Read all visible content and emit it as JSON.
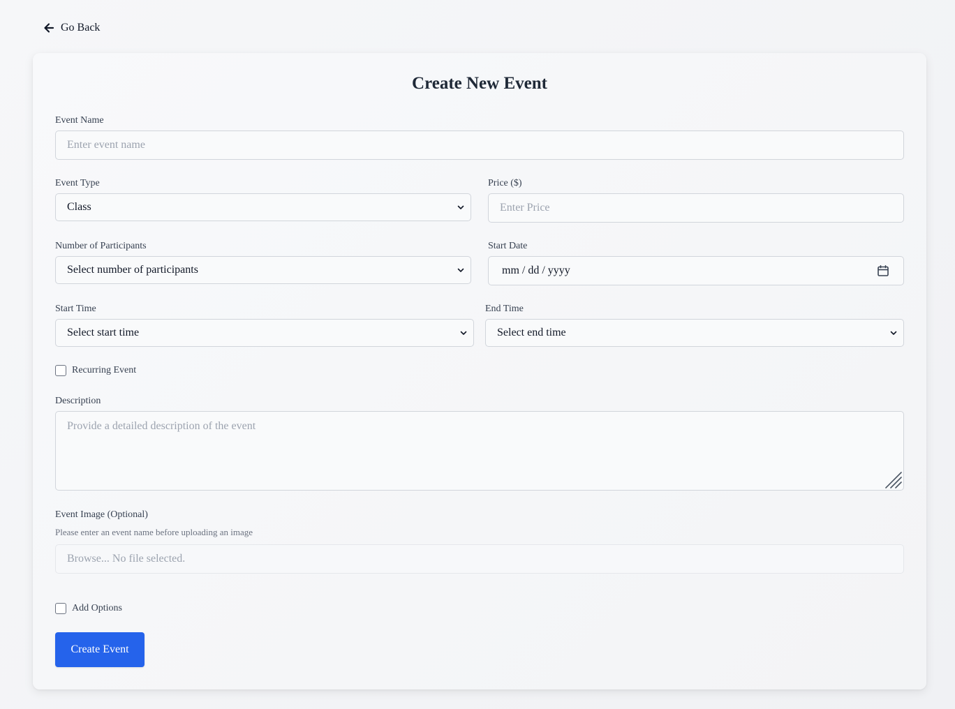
{
  "nav": {
    "back_label": "Go Back"
  },
  "form": {
    "title": "Create New Event",
    "event_name": {
      "label": "Event Name",
      "placeholder": "Enter event name"
    },
    "event_type": {
      "label": "Event Type",
      "value": "Class"
    },
    "price": {
      "label": "Price ($)",
      "placeholder": "Enter Price"
    },
    "participants": {
      "label": "Number of Participants",
      "value": "Select number of participants"
    },
    "start_date": {
      "label": "Start Date",
      "value": "mm / dd / yyyy"
    },
    "start_time": {
      "label": "Start Time",
      "value": "Select start time"
    },
    "end_time": {
      "label": "End Time",
      "value": "Select end time"
    },
    "recurring": {
      "label": "Recurring Event",
      "checked": false
    },
    "description": {
      "label": "Description",
      "placeholder": "Provide a detailed description of the event"
    },
    "image": {
      "label": "Event Image (Optional)",
      "hint": "Please enter an event name before uploading an image",
      "value": "Browse... No file selected."
    },
    "add_options": {
      "label": "Add Options",
      "checked": false
    },
    "submit_label": "Create Event"
  },
  "colors": {
    "primary": "#2563eb",
    "background": "#f3f4f6",
    "border": "#d1d5db"
  },
  "icons": {
    "back": "arrow-left-icon",
    "select": "chevron-down-icon",
    "calendar": "calendar-icon"
  }
}
